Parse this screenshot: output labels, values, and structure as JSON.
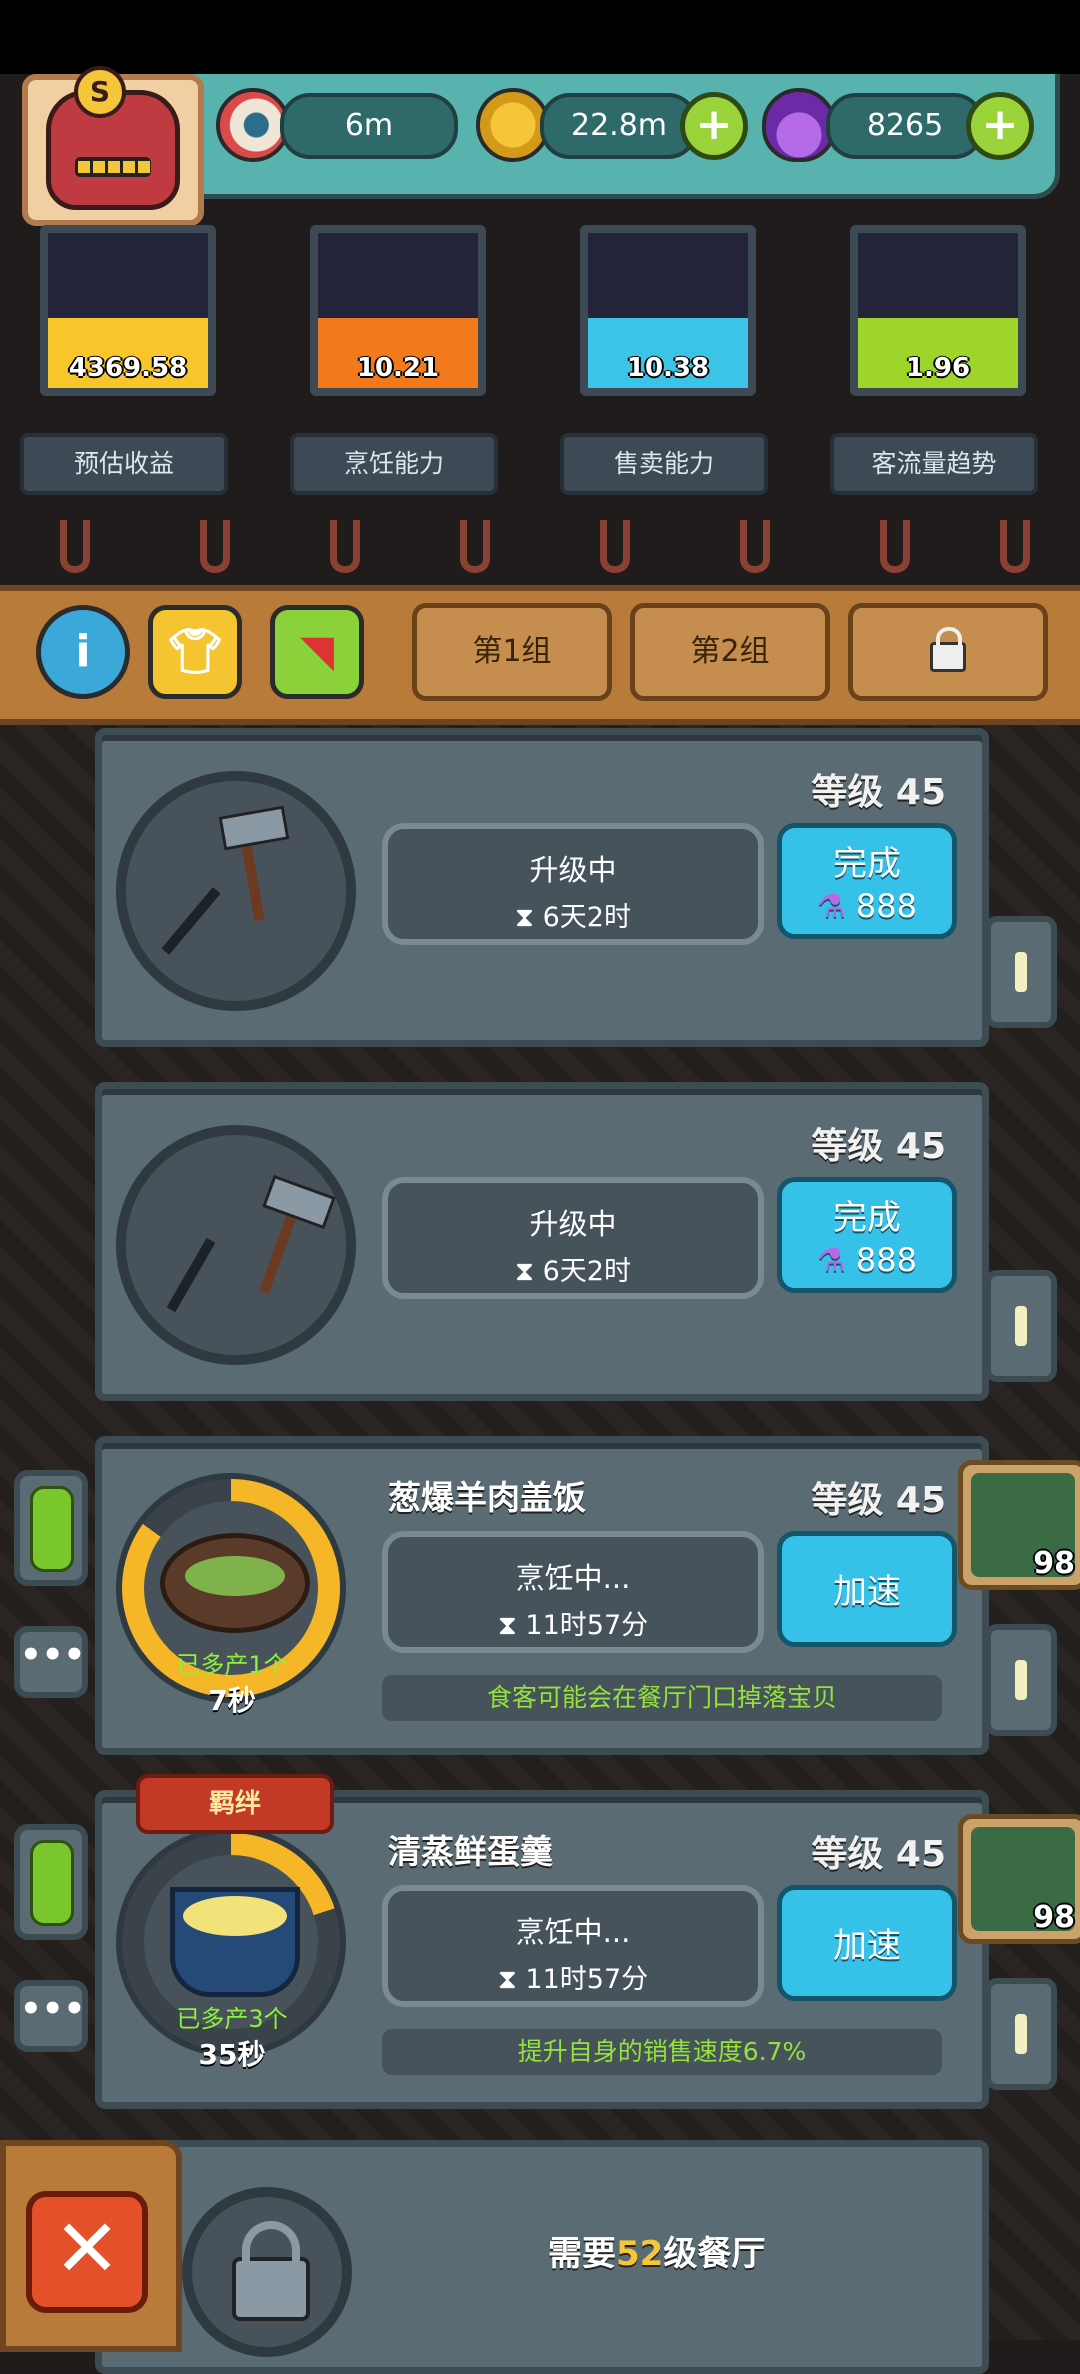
{
  "resources": {
    "eyeball": "6m",
    "coins": "22.8m",
    "potions": "8265"
  },
  "stats": [
    {
      "value": "4369.58",
      "label": "预估收益",
      "color": "#f8c52a",
      "fill": 0.45
    },
    {
      "value": "10.21",
      "label": "烹饪能力",
      "color": "#f27a1c",
      "fill": 0.45
    },
    {
      "value": "10.38",
      "label": "售卖能力",
      "color": "#3cc4e6",
      "fill": 0.45
    },
    {
      "value": "1.96",
      "label": "客流量趋势",
      "color": "#9ed52b",
      "fill": 0.45
    }
  ],
  "tabs": {
    "group1": "第1组",
    "group2": "第2组"
  },
  "cards": [
    {
      "level": "等级 45",
      "status": "升级中",
      "time": "6天2时",
      "action": "完成",
      "cost": "888"
    },
    {
      "level": "等级 45",
      "status": "升级中",
      "time": "6天2时",
      "action": "完成",
      "cost": "888"
    },
    {
      "dish": "葱爆羊肉盖饭",
      "level": "等级 45",
      "status": "烹饪中...",
      "time": "11时57分",
      "action": "加速",
      "effect": "食客可能会在餐厅门口掉落宝贝",
      "extra": "已多产1个",
      "seconds": "7秒",
      "side_count": "98",
      "progress": 0.85
    },
    {
      "dish": "清蒸鲜蛋羹",
      "level": "等级 45",
      "status": "烹饪中...",
      "time": "11时57分",
      "action": "加速",
      "effect": "提升自身的销售速度6.7%",
      "extra": "已多产3个",
      "seconds": "35秒",
      "side_count": "98",
      "bond": "羁绊",
      "progress": 0.2
    }
  ],
  "locked": {
    "prefix": "需要",
    "level": "52",
    "suffix": "级餐厅"
  },
  "icons": {
    "info": "info-icon",
    "shirt": "shirt-icon",
    "shoe": "shoe-icon",
    "lock": "lock-icon",
    "close": "close-icon",
    "hourglass": "hourglass-icon",
    "potion": "potion-icon"
  }
}
